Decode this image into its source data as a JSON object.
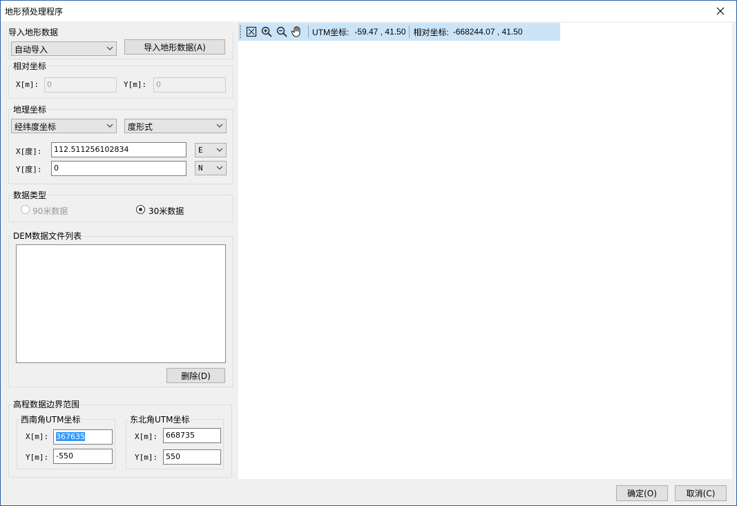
{
  "window": {
    "title": "地形预处理程序"
  },
  "import": {
    "group_title": "导入地形数据",
    "mode": "自动导入",
    "button": "导入地形数据(A)"
  },
  "relative": {
    "group_title": "相对坐标",
    "x_label": "X[m]:",
    "x_value": "0",
    "y_label": "Y[m]:",
    "y_value": "0"
  },
  "geo": {
    "group_title": "地理坐标",
    "coord_type": "经纬度坐标",
    "format": "度形式",
    "x_label": "X[度]:",
    "x_value": "112.511256102834",
    "x_dir": "E",
    "y_label": "Y[度]:",
    "y_value": "0",
    "y_dir": "N"
  },
  "datatype": {
    "group_title": "数据类型",
    "option_90": "90米数据",
    "option_30": "30米数据",
    "selected": "30米数据"
  },
  "dem": {
    "group_title": "DEM数据文件列表",
    "delete_button": "删除(D)"
  },
  "bounds": {
    "group_title": "高程数据边界范围",
    "sw_title": "西南角UTM坐标",
    "sw_x_label": "X[m]:",
    "sw_x_value": "367635",
    "sw_y_label": "Y[m]:",
    "sw_y_value": "-550",
    "ne_title": "东北角UTM坐标",
    "ne_x_label": "X[m]:",
    "ne_x_value": "668735",
    "ne_y_label": "Y[m]:",
    "ne_y_value": "550"
  },
  "toolbar": {
    "utm_label": "UTM坐标:",
    "utm_value": "-59.47 , 41.50",
    "rel_label": "相对坐标:",
    "rel_value": "-668244.07 , 41.50",
    "icons": [
      "fit-extent-icon",
      "zoom-in-icon",
      "zoom-out-icon",
      "pan-hand-icon"
    ]
  },
  "footer": {
    "ok_button": "确定(O)",
    "cancel_button": "取消(C)"
  }
}
